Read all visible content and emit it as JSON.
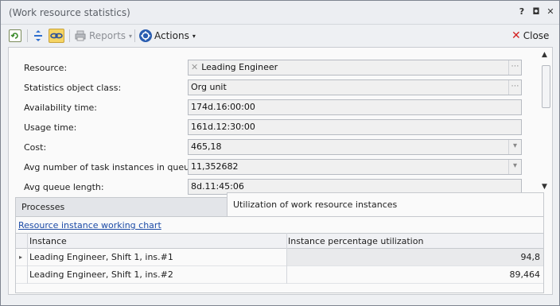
{
  "window": {
    "title": "(Work resource statistics)",
    "controls": [
      "?",
      "◘",
      "✕"
    ]
  },
  "toolbar": {
    "reports_label": "Reports",
    "actions_label": "Actions",
    "close_label": "Close"
  },
  "form": {
    "fields": [
      {
        "label": "Resource:",
        "value": "Leading Engineer"
      },
      {
        "label": "Statistics object class:",
        "value": "Org unit"
      },
      {
        "label": "Availability time:",
        "value": "174d.16:00:00"
      },
      {
        "label": "Usage time:",
        "value": "161d.12:30:00"
      },
      {
        "label": "Cost:",
        "value": "465,18"
      },
      {
        "label": "Avg number of task instances in queue:",
        "value": "11,352682"
      },
      {
        "label": "Avg queue length:",
        "value": "8d.11:45:06"
      }
    ]
  },
  "tabs": {
    "items": [
      "Processes",
      "Utilization of work resource instances"
    ],
    "active_index": 1
  },
  "panel": {
    "link_label": "Resource instance working chart",
    "columns": [
      "Instance",
      "Instance percentage utilization"
    ],
    "rows": [
      {
        "instance": "Leading Engineer, Shift 1, ins.#1",
        "utilization": "94,8"
      },
      {
        "instance": "Leading Engineer, Shift 1, ins.#2",
        "utilization": "89,464"
      }
    ]
  }
}
